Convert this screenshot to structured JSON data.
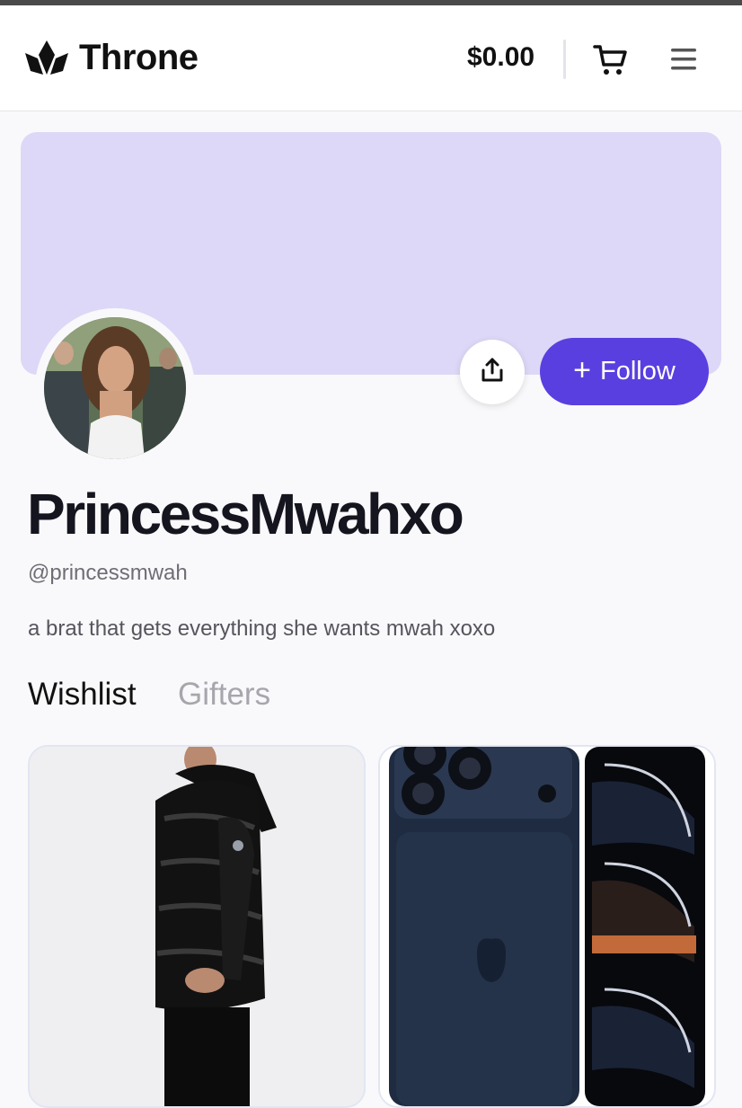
{
  "header": {
    "brand_name": "Throne",
    "balance": "$0.00",
    "icons": [
      "throne-logo-icon",
      "cart-icon",
      "hamburger-menu-icon"
    ]
  },
  "profile": {
    "display_name": "PrincessMwahxo",
    "handle": "@princessmwah",
    "bio": "a brat that gets everything she wants mwah xoxo",
    "follow_label": "Follow",
    "banner_color": "#ddd8f7",
    "accent_color": "#5a3fe0"
  },
  "tabs": [
    {
      "label": "Wishlist",
      "active": true
    },
    {
      "label": "Gifters",
      "active": false
    }
  ],
  "wishlist": {
    "items": [
      {
        "image": "black-puffer-jacket-image"
      },
      {
        "image": "smartphone-image"
      }
    ]
  }
}
